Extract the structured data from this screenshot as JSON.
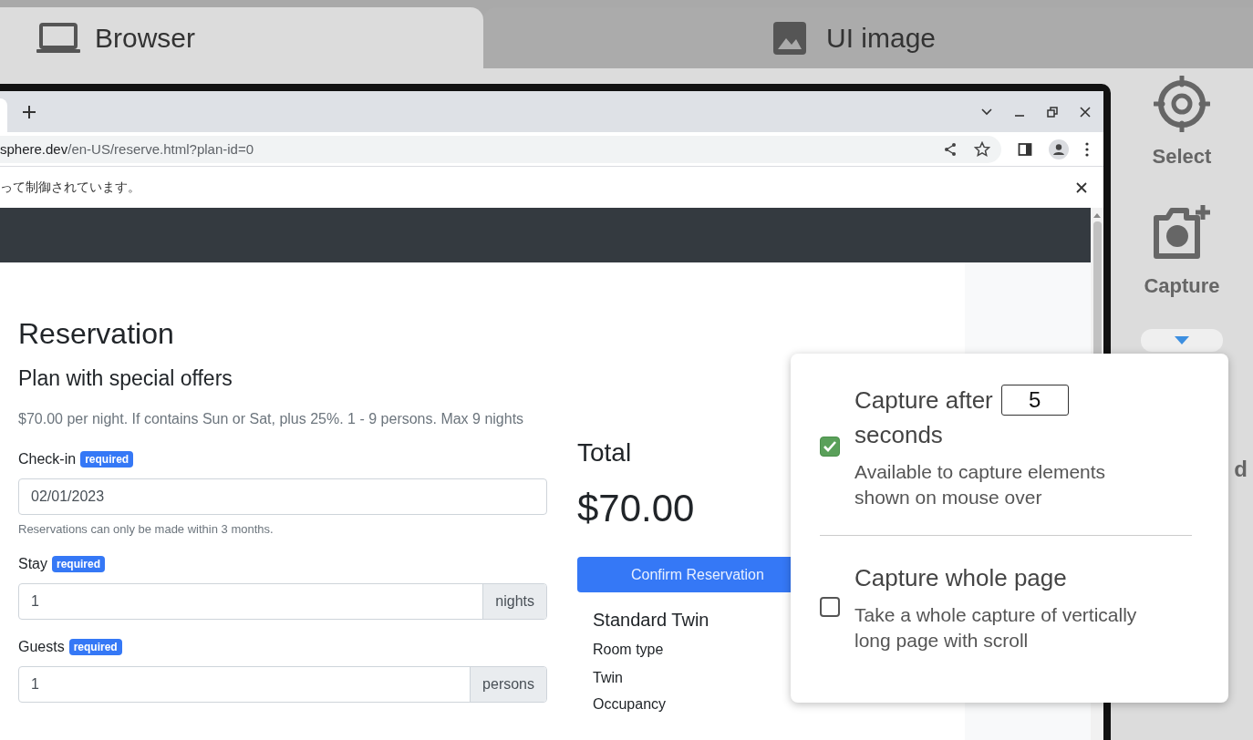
{
  "tabs": [
    {
      "label": "Browser",
      "kind": "laptop",
      "selected": true
    },
    {
      "label": "UI image",
      "kind": "image",
      "selected": false
    }
  ],
  "browser": {
    "url_host": "sphere.dev",
    "url_path": "/en-US/reserve.html?plan-id=0",
    "infobar": "って制御されています。"
  },
  "page": {
    "title": "Reservation",
    "plan": "Plan with special offers",
    "description": "$70.00 per night. If contains Sun or Sat, plus 25%. 1 - 9 persons. Max 9 nights",
    "fields": [
      {
        "label": "Check-in",
        "badge": "required",
        "value": "02/01/2023",
        "help": "Reservations can only be made within 3 months."
      },
      {
        "label": "Stay",
        "badge": "required",
        "value": "1",
        "addon": "nights"
      },
      {
        "label": "Guests",
        "badge": "required",
        "value": "1",
        "addon": "persons"
      }
    ],
    "total_label": "Total",
    "total": "$70.00",
    "confirm": "Confirm Reservation",
    "room_name": "Standard Twin",
    "room_type_label": "Room type",
    "room_type": "Twin",
    "occupancy_label": "Occupancy"
  },
  "sidebar": {
    "tools": [
      {
        "label": "Select",
        "kind": "target"
      },
      {
        "label": "Capture",
        "kind": "camera"
      }
    ],
    "partial_label": "d"
  },
  "capture_menu": {
    "options": [
      {
        "kind": "delay",
        "title": "Capture after",
        "seconds": "5",
        "title_after": "seconds",
        "description": "Available to capture elements shown on mouse over",
        "checked": true
      },
      {
        "kind": "whole",
        "title": "Capture whole page",
        "description": "Take a whole capture of vertically long page with scroll",
        "checked": false
      }
    ]
  }
}
